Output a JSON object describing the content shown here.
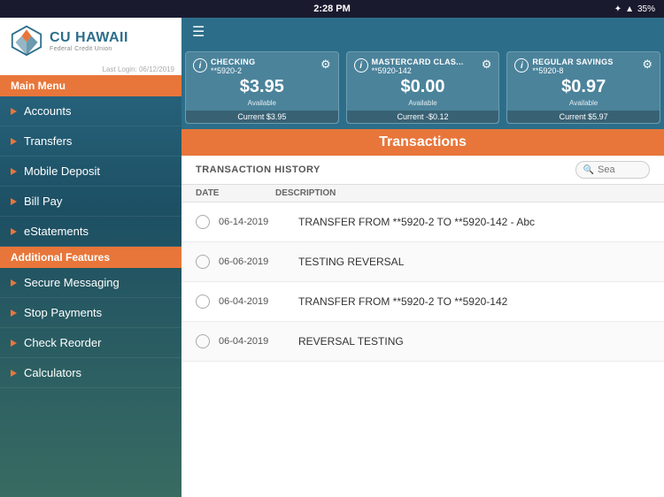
{
  "statusBar": {
    "time": "2:28 PM",
    "battery": "35%",
    "batteryIcon": "🔋"
  },
  "sidebar": {
    "logo": {
      "name": "CU HAWAII",
      "sub": "Federal Credit Union"
    },
    "lastLogin": "Last Login: 06/12/2019",
    "mainMenuLabel": "Main Menu",
    "mainItems": [
      {
        "label": "Accounts",
        "id": "accounts"
      },
      {
        "label": "Transfers",
        "id": "transfers"
      },
      {
        "label": "Mobile Deposit",
        "id": "mobile-deposit"
      },
      {
        "label": "Bill Pay",
        "id": "bill-pay"
      },
      {
        "label": "eStatements",
        "id": "estatements"
      }
    ],
    "additionalFeaturesLabel": "Additional Features",
    "additionalItems": [
      {
        "label": "Secure Messaging",
        "id": "secure-messaging"
      },
      {
        "label": "Stop Payments",
        "id": "stop-payments"
      },
      {
        "label": "Check Reorder",
        "id": "check-reorder"
      },
      {
        "label": "Calculators",
        "id": "calculators"
      }
    ]
  },
  "topNav": {
    "hamburgerLabel": "☰"
  },
  "accounts": [
    {
      "name": "CHECKING",
      "number": "**5920-2",
      "balance": "$3.95",
      "availableLabel": "Available",
      "current": "Current $3.95"
    },
    {
      "name": "MASTERCARD CLAS...",
      "number": "**5920-142",
      "balance": "$0.00",
      "availableLabel": "Available",
      "current": "Current -$0.12"
    },
    {
      "name": "REGULAR SAVINGS",
      "number": "**5920-8",
      "balance": "$0.97",
      "availableLabel": "Available",
      "current": "Current $5.97"
    }
  ],
  "transactions": {
    "sectionTitle": "Transactions",
    "historyLabel": "TRANSACTION HISTORY",
    "searchPlaceholder": "Sea",
    "columns": {
      "date": "DATE",
      "description": "DESCRIPTION"
    },
    "rows": [
      {
        "date": "06-14-2019",
        "description": "TRANSFER FROM **5920-2 TO **5920-142 - Abc"
      },
      {
        "date": "06-06-2019",
        "description": "TESTING REVERSAL"
      },
      {
        "date": "06-04-2019",
        "description": "TRANSFER FROM **5920-2 TO **5920-142"
      },
      {
        "date": "06-04-2019",
        "description": "REVERSAL TESTING"
      }
    ]
  },
  "colors": {
    "accent": "#e8763a",
    "primary": "#2c6e8a",
    "sidebarBg": "#2c6e8a"
  }
}
